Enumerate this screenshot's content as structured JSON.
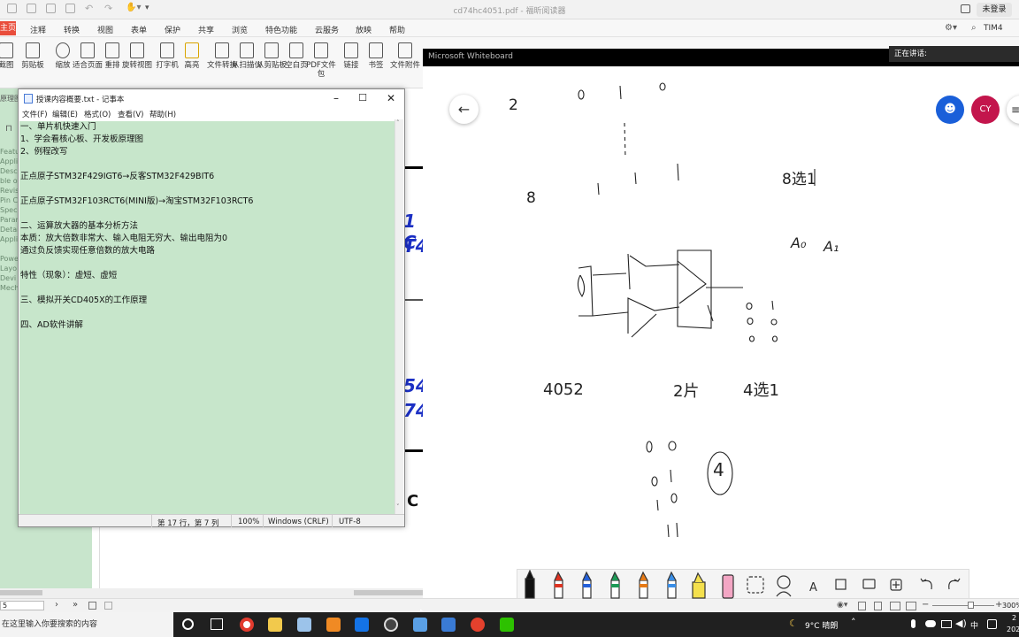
{
  "pdf_app": {
    "title": "cd74hc4051.pdf - 福昕阅读器",
    "login_label": "未登录",
    "search_value": "TIM4",
    "menu_items": [
      "主页",
      "注释",
      "转换",
      "视图",
      "表单",
      "保护",
      "共享",
      "浏览",
      "特色功能",
      "云服务",
      "放映",
      "帮助"
    ],
    "ribbon_buttons": [
      "截图",
      "剪贴板",
      "缩放",
      "适合页面",
      "重排",
      "旋转视图",
      "打字机",
      "高亮",
      "文件转换",
      "从扫描仪",
      "从剪贴板",
      "空白页",
      "PDF文件包",
      "链接",
      "书签",
      "文件附件"
    ],
    "toc_items": [
      "Featu",
      "Applic",
      "Descr",
      "ble of",
      "Revisi",
      "Pin Co",
      "Specif",
      "Param",
      "Detail",
      "Applic",
      "Powe",
      "Layo",
      "Devi",
      "Mech"
    ],
    "page_input": "5",
    "zoom": "300%",
    "doc_fragments": [
      "1 C",
      "T4",
      "54",
      "74",
      "C"
    ],
    "side_label": "原理图"
  },
  "notepad": {
    "title": "授课内容概要.txt - 记事本",
    "menu": [
      "文件(F)",
      "编辑(E)",
      "格式(O)",
      "查看(V)",
      "帮助(H)"
    ],
    "lines": [
      "一、单片机快速入门",
      "1、学会看核心板、开发板原理图",
      "2、例程改写",
      "",
      "正点原子STM32F429IGT6→反客STM32F429BIT6",
      "",
      "正点原子STM32F103RCT6(MINI版)→淘宝STM32F103RCT6",
      "",
      "二、运算放大器的基本分析方法",
      "本质：放大倍数非常大、输入电阻无穷大、输出电阻为0",
      "通过负反馈实现任意倍数的放大电路",
      "",
      "特性（现象）：虚短、虚短",
      "",
      "三、模拟开关CD405X的工作原理",
      "",
      "四、AD软件讲解"
    ],
    "status": {
      "position": "第 17 行，第 7 列",
      "zoom": "100%",
      "line_ending": "Windows (CRLF)",
      "encoding": "UTF-8"
    }
  },
  "whiteboard": {
    "title": "Microsoft Whiteboard",
    "sharing_label": "正在讲话:",
    "avatar_initials": "CY",
    "sketch_text": [
      "2",
      "8",
      "8选1",
      "A₀",
      "A₁",
      "4052",
      "2片",
      "4选1",
      "4"
    ],
    "tools": [
      "pen-black",
      "pen-red",
      "pen-blue",
      "pen-green",
      "pen-orange",
      "pen-lightblue",
      "highlighter",
      "eraser",
      "lasso",
      "shapes",
      "text",
      "note",
      "image",
      "add",
      "undo",
      "redo"
    ]
  },
  "taskbar": {
    "search_placeholder": "在这里输入你要搜索的内容",
    "weather": "9°C 晴朗",
    "ime": "中",
    "time_fragment": "2",
    "date_fragment": "202"
  }
}
